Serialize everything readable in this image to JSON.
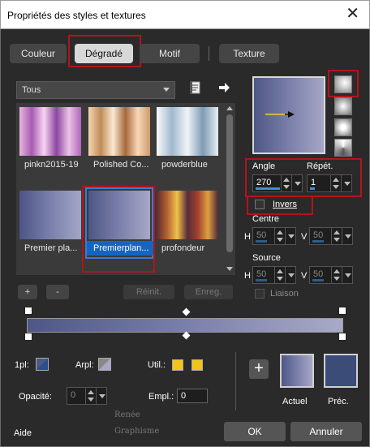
{
  "window": {
    "title": "Propriétés des styles et textures",
    "close": "✕"
  },
  "tabs": [
    {
      "label": "Couleur"
    },
    {
      "label": "Dégradé",
      "selected": true
    },
    {
      "label": "Motif"
    },
    {
      "label": "Texture"
    }
  ],
  "gallery": {
    "filter": "Tous",
    "items": [
      {
        "label": "pinkn2015-19",
        "gradient": "linear-gradient(to right,#e7b6df,#a85ab0,#f6d4f1,#8c46a0,#eac2e6,#b166b8)"
      },
      {
        "label": "Polished Co...",
        "gradient": "linear-gradient(to right,#f6d6b1,#c28b58,#fbe9d2,#a8683b,#f7d8b8,#cf9a6c)"
      },
      {
        "label": "powderblue",
        "gradient": "linear-gradient(to right,#fafafa,#9fb9cf,#f1f4f7,#7d9bb4,#e8eef3)"
      },
      {
        "label": "Premier pla...",
        "gradient": "linear-gradient(to right,#4c5586,#7a80ab,#a3a6c6)"
      },
      {
        "label": "Premierplan...",
        "gradient": "linear-gradient(to right,#4d5684,#7b80ab,#a7a8c7)",
        "selected": true
      },
      {
        "label": "profondeur",
        "gradient": "linear-gradient(to right,#5c2a31,#b2612f,#f0c24a,#5a2b3a,#a0402f,#e0a040,#4c2a3a)"
      }
    ]
  },
  "gallery_buttons": {
    "add": "+",
    "remove": "-",
    "reinit": "Réinit.",
    "enreg": "Enreg."
  },
  "preview": {
    "gradient": "linear-gradient(to right,#4e5785,#7a7faa,#a6a7c6)"
  },
  "angle": {
    "label": "Angle",
    "value": "270"
  },
  "repet": {
    "label": "Répét.",
    "value": "1"
  },
  "invers": {
    "label": "Invers"
  },
  "centre": {
    "label": "Centre",
    "h_label": "H",
    "h_value": "50",
    "v_label": "V",
    "v_value": "50"
  },
  "source": {
    "label": "Source",
    "h_label": "H",
    "h_value": "50",
    "v_label": "V",
    "v_value": "50"
  },
  "liaison": {
    "label": "Liaison"
  },
  "stops": {
    "pl1_label": "1pl:",
    "arpl_label": "Arpl:",
    "util_label": "Util.:",
    "opacity_label": "Opacité:",
    "opacity_value": "0",
    "empl_label": "Empl.:",
    "empl_value": "0",
    "util_color": "#f2c318"
  },
  "swatches": {
    "add": "+",
    "actuel_label": "Actuel",
    "prec_label": "Préc.",
    "prec_color": "#3c4c78"
  },
  "footer": {
    "aide": "Aide",
    "ok": "OK",
    "annuler": "Annuler"
  },
  "watermark": {
    "line1": "Renée",
    "line2": "Graphisme"
  }
}
